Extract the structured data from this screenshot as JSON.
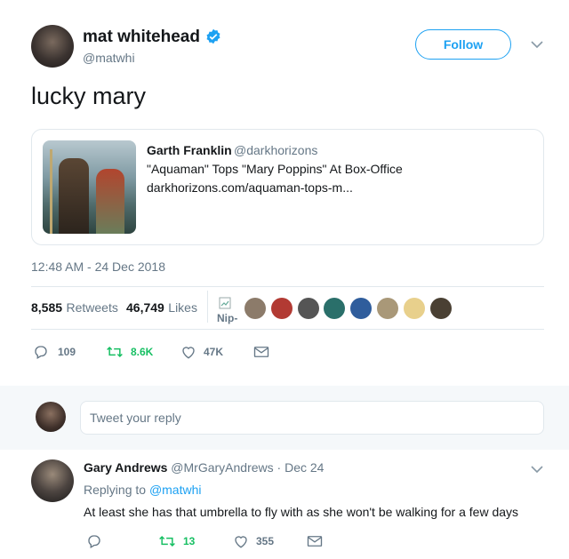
{
  "tweet": {
    "author_name": "mat whitehead",
    "author_handle": "@matwhi",
    "follow_label": "Follow",
    "text": "lucky mary",
    "timestamp": "12:48 AM - 24 Dec 2018",
    "card": {
      "author_name": "Garth Franklin",
      "author_handle": "@darkhorizons",
      "title": "\"Aquaman\" Tops \"Mary Poppins\" At Box-Office",
      "link": "darkhorizons.com/aquaman-tops-m..."
    },
    "stats": {
      "retweets_count": "8,585",
      "retweets_label": "Retweets",
      "likes_count": "46,749",
      "likes_label": "Likes",
      "broken_image_alt": "Nip-"
    },
    "actions": {
      "replies": "109",
      "retweets": "8.6K",
      "likes": "47K"
    }
  },
  "reply_box": {
    "placeholder": "Tweet your reply"
  },
  "reply": {
    "author_name": "Gary Andrews",
    "author_handle": "@MrGaryAndrews",
    "date": "· Dec 24",
    "replying_to_label": "Replying to",
    "replying_to_handle": "@matwhi",
    "text": "At least she has that umbrella to fly with as she won't be walking for a few days",
    "actions": {
      "replies": "",
      "retweets": "13",
      "likes": "355"
    }
  },
  "colors": {
    "accent": "#1da1f2",
    "retweet_green": "#17bf63",
    "muted": "#657786",
    "border": "#e1e8ed",
    "verified": "#1da1f2"
  }
}
